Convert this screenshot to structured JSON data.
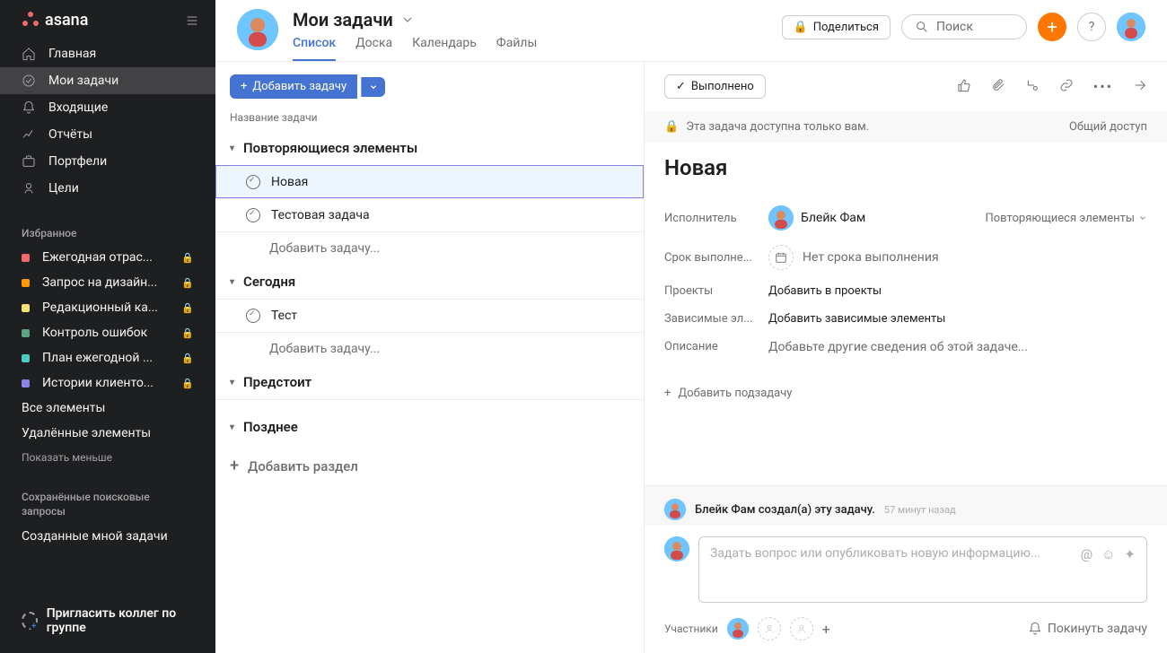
{
  "brand": "asana",
  "nav": {
    "home": "Главная",
    "my_tasks": "Мои задачи",
    "inbox": "Входящие",
    "reports": "Отчёты",
    "portfolios": "Портфели",
    "goals": "Цели"
  },
  "favorites": {
    "label": "Избранное",
    "items": [
      {
        "label": "Ежегодная отрас...",
        "color": "#f06a6a",
        "locked": true
      },
      {
        "label": "Запрос на дизайн...",
        "color": "#fd9a00",
        "locked": true
      },
      {
        "label": "Редакционный ка...",
        "color": "#f8df72",
        "locked": true
      },
      {
        "label": "Контроль ошибок",
        "color": "#5da283",
        "locked": true
      },
      {
        "label": "План ежегодной ...",
        "color": "#4ecbc4",
        "locked": true
      },
      {
        "label": "Истории клиенто...",
        "color": "#8d84e8",
        "locked": true
      }
    ],
    "all": "Все элементы",
    "deleted": "Удалённые элементы",
    "show_less": "Показать меньше"
  },
  "saved_searches": {
    "label": "Сохранённые поисковые запросы",
    "item": "Созданные мной задачи"
  },
  "invite": "Пригласить коллег по группе",
  "header": {
    "title": "Мои задачи",
    "tabs": {
      "list": "Список",
      "board": "Доска",
      "calendar": "Календарь",
      "files": "Файлы"
    },
    "share": "Поделиться",
    "search": "Поиск"
  },
  "list": {
    "add_task": "Добавить задачу",
    "column_header": "Название задачи",
    "sections": [
      {
        "name": "Повторяющиеся элементы",
        "tasks": [
          "Новая",
          "Тестовая задача"
        ],
        "add": "Добавить задачу..."
      },
      {
        "name": "Сегодня",
        "tasks": [
          "Тест"
        ],
        "add": "Добавить задачу..."
      },
      {
        "name": "Предстоит",
        "tasks": [],
        "add": null
      },
      {
        "name": "Позднее",
        "tasks": [],
        "add": null
      }
    ],
    "add_section": "Добавить раздел"
  },
  "detail": {
    "complete": "Выполнено",
    "privacy_msg": "Эта задача доступна только вам.",
    "share_access": "Общий доступ",
    "title": "Новая",
    "fields": {
      "assignee_label": "Исполнитель",
      "assignee_value": "Блейк Фам",
      "section_value": "Повторяющиеся элементы",
      "due_label": "Срок выполне...",
      "due_value": "Нет срока выполнения",
      "projects_label": "Проекты",
      "projects_value": "Добавить в проекты",
      "deps_label": "Зависимые эл...",
      "deps_value": "Добавить зависимые элементы",
      "desc_label": "Описание",
      "desc_placeholder": "Добавьте другие сведения об этой задаче..."
    },
    "add_subtask": "Добавить подзадачу",
    "activity_text": "Блейк Фам создал(а) эту задачу.",
    "activity_time": "57 минут назад",
    "comment_placeholder": "Задать вопрос или опубликовать новую информацию...",
    "participants_label": "Участники",
    "leave": "Покинуть задачу"
  }
}
